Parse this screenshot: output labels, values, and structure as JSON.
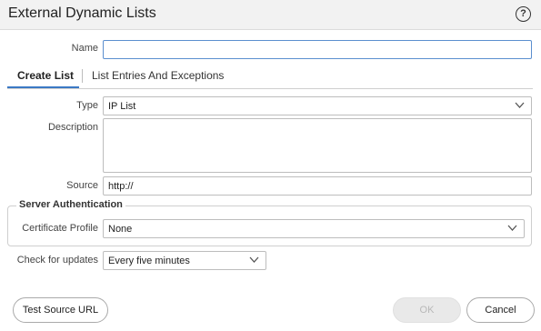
{
  "dialog": {
    "title": "External Dynamic Lists",
    "help_icon": "help-circle-icon",
    "help_symbol": "?"
  },
  "form": {
    "name_label": "Name",
    "name_value": ""
  },
  "tabs": [
    {
      "label": "Create List",
      "active": true
    },
    {
      "label": "List Entries And Exceptions",
      "active": false
    }
  ],
  "create_list": {
    "type_label": "Type",
    "type_value": "IP List",
    "description_label": "Description",
    "description_value": "",
    "source_label": "Source",
    "source_value": "http://",
    "server_auth_legend": "Server Authentication",
    "cert_profile_label": "Certificate Profile",
    "cert_profile_value": "None",
    "check_updates_label": "Check for updates",
    "check_updates_value": "Every five minutes"
  },
  "buttons": {
    "test_source_url": "Test Source URL",
    "ok": "OK",
    "ok_enabled": false,
    "cancel": "Cancel"
  },
  "colors": {
    "accent": "#3b79c4",
    "focus_border": "#5b8fcf"
  }
}
